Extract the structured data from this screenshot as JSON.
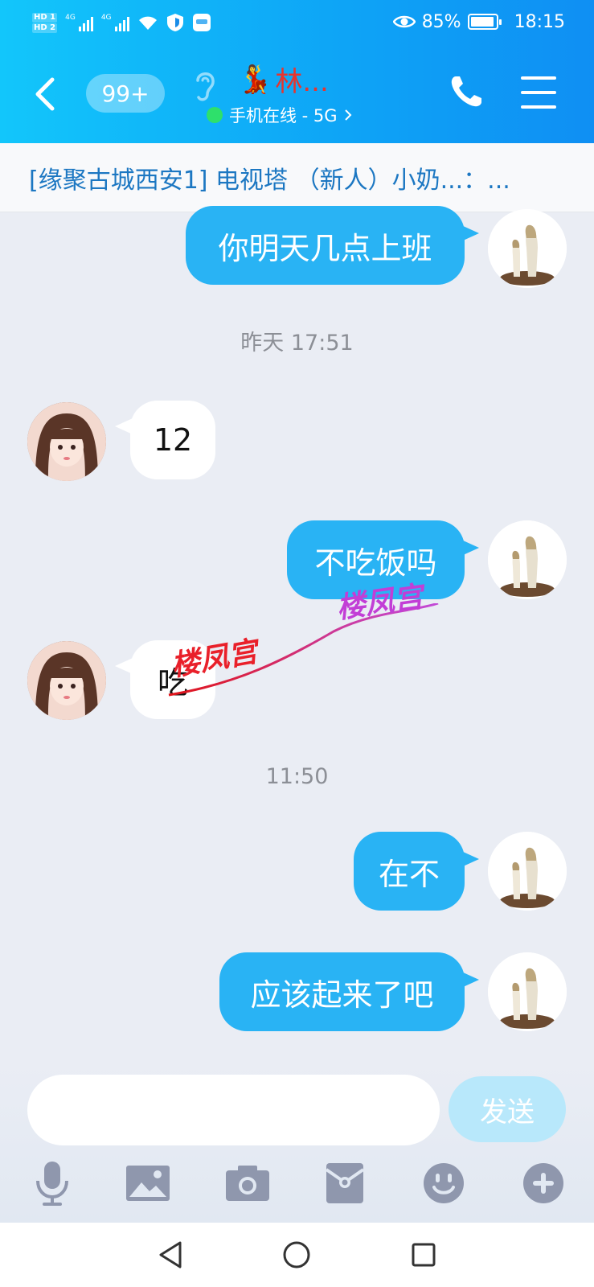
{
  "status_bar": {
    "battery": "85%",
    "time": "18:15"
  },
  "header": {
    "unread_badge": "99+",
    "contact_name": "林...",
    "online_status": "手机在线 - 5G"
  },
  "group_notice": "[缘聚古城西安1] 电视塔 （新人）小奶...：...",
  "timestamps": [
    "昨天 17:51",
    "11:50"
  ],
  "messages": [
    {
      "from": "me",
      "text": "你明天几点上班"
    },
    {
      "from": "her",
      "text": "12"
    },
    {
      "from": "me",
      "text": "不吃饭吗"
    },
    {
      "from": "her",
      "text": "吃"
    },
    {
      "from": "me",
      "text": "在不"
    },
    {
      "from": "me",
      "text": "应该起来了吧"
    }
  ],
  "watermarks": [
    "楼凤宫",
    "楼凤宫"
  ],
  "input": {
    "placeholder": "",
    "send_label": "发送"
  },
  "colors": {
    "header_start": "#12c6fb",
    "header_end": "#0f8ff3",
    "sent_bubble": "#29b3f4",
    "send_button": "#b8e8fb"
  },
  "toolbar_icons": [
    "microphone-icon",
    "image-icon",
    "camera-icon",
    "red-packet-icon",
    "emoji-icon",
    "plus-icon"
  ]
}
